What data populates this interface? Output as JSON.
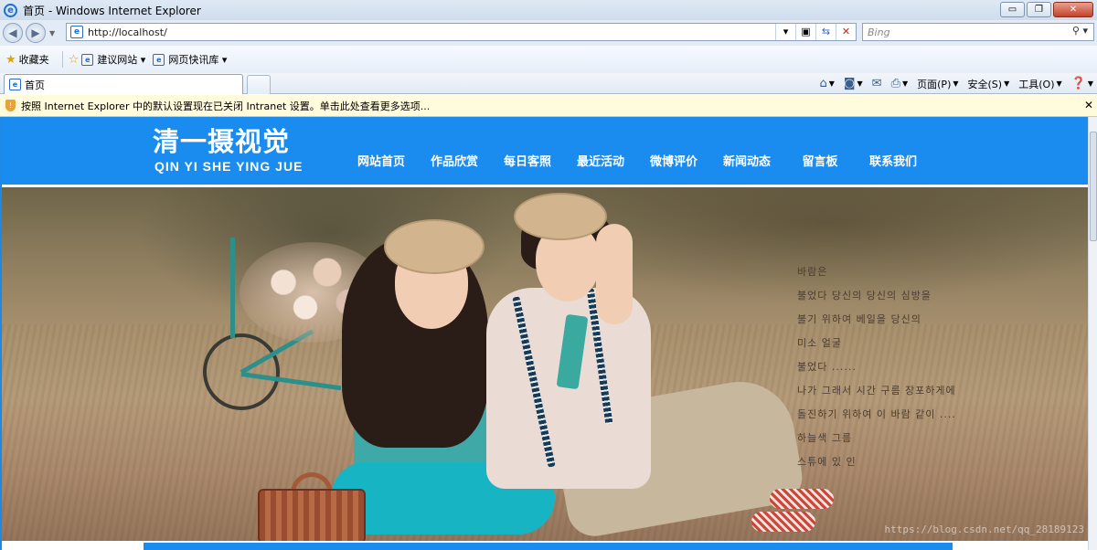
{
  "window": {
    "title": "首页 - Windows Internet Explorer",
    "controls": {
      "minimize": "▭",
      "restore": "❐",
      "close": "✕"
    }
  },
  "address_bar": {
    "url": "http://localhost/",
    "search_placeholder": "Bing"
  },
  "favorites_bar": {
    "favorites_label": "收藏夹",
    "items": [
      {
        "label": "建议网站 ▾"
      },
      {
        "label": "网页快讯库 ▾"
      }
    ]
  },
  "tabs": [
    {
      "label": "首页"
    }
  ],
  "command_bar": {
    "page_menu": "页面(P)",
    "safety_menu": "安全(S)",
    "tools_menu": "工具(O)"
  },
  "info_bar": {
    "message": "按照 Internet Explorer 中的默认设置现在已关闭 Intranet 设置。单击此处查看更多选项..."
  },
  "site": {
    "logo_cn": "清一摄视觉",
    "logo_pinyin": "QIN YI SHE YING JUE",
    "nav": [
      {
        "label": "网站首页"
      },
      {
        "label": "作品欣赏"
      },
      {
        "label": "每日客照"
      },
      {
        "label": "最近活动"
      },
      {
        "label": "微博评价"
      },
      {
        "label": "新闻动态"
      },
      {
        "label": "留言板"
      },
      {
        "label": "联系我们"
      }
    ],
    "banner_poem": [
      "바람은",
      "불었다 당신의 당신의 심방을",
      "불기 위하여 베일을 당신의",
      "미소 얼굴",
      "불었다 ......",
      "나가 그래서 시간 구름 장포하게에",
      "돌진하기 위하여 이 바람 같이 ....",
      "하늘색 그름",
      "스튜에 있 인"
    ],
    "watermark": "https://blog.csdn.net/qq_28189123"
  },
  "colors": {
    "header_blue": "#1a8cf0",
    "nav_text": "#ffffff"
  }
}
